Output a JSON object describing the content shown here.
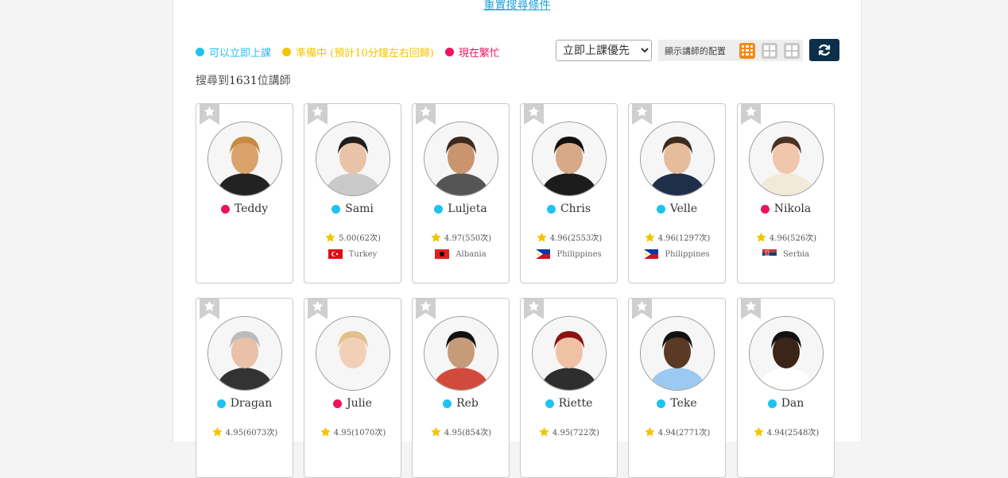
{
  "reset_link": "重置搜尋條件",
  "legend": [
    {
      "label": "可以立即上課",
      "color": "#1fc3ef"
    },
    {
      "label": "準備中 (預計10分鐘左右回歸)",
      "color": "#f5c400"
    },
    {
      "label": "現在繁忙",
      "color": "#f0125a"
    }
  ],
  "sort": {
    "selected": "立即上課優先"
  },
  "layout": {
    "label": "顯示講師的配置",
    "active_color": "#f48a17",
    "inactive_color": "#c8c8c8"
  },
  "count": {
    "prefix": "搜尋到",
    "number": "1631",
    "suffix": "位講師"
  },
  "colors": {
    "available": "#1fc3ef",
    "busy": "#f0125a",
    "star": "#f5c400"
  },
  "teachers": [
    {
      "name": "Teddy",
      "status": "busy",
      "rating": "",
      "country": ""
    },
    {
      "name": "Sami",
      "status": "available",
      "rating": "5.00(62次)",
      "country": "Turkey",
      "flag": "tr"
    },
    {
      "name": "Luljeta",
      "status": "available",
      "rating": "4.97(550次)",
      "country": "Albania",
      "flag": "al"
    },
    {
      "name": "Chris",
      "status": "available",
      "rating": "4.96(2553次)",
      "country": "Philippines",
      "flag": "ph"
    },
    {
      "name": "Velle",
      "status": "available",
      "rating": "4.96(1297次)",
      "country": "Philippines",
      "flag": "ph"
    },
    {
      "name": "Nikola",
      "status": "busy",
      "rating": "4.96(526次)",
      "country": "Serbia",
      "flag": "rs"
    },
    {
      "name": "Dragan",
      "status": "available",
      "rating": "4.95(6073次)",
      "country": ""
    },
    {
      "name": "Julie",
      "status": "busy",
      "rating": "4.95(1070次)",
      "country": ""
    },
    {
      "name": "Reb",
      "status": "available",
      "rating": "4.95(854次)",
      "country": ""
    },
    {
      "name": "Riette",
      "status": "available",
      "rating": "4.95(722次)",
      "country": ""
    },
    {
      "name": "Teke",
      "status": "available",
      "rating": "4.94(2771次)",
      "country": ""
    },
    {
      "name": "Dan",
      "status": "available",
      "rating": "4.94(2548次)",
      "country": ""
    }
  ]
}
